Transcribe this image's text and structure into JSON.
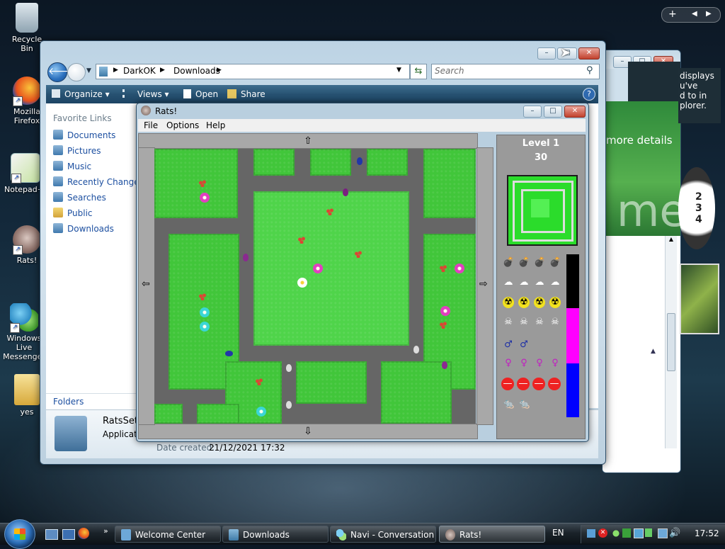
{
  "desktop": {
    "icons": [
      {
        "label": "Recycle Bin"
      },
      {
        "label": "Mozilla Firefox"
      },
      {
        "label": "Notepad++"
      },
      {
        "label": "Rats!"
      },
      {
        "label": "Windows Live Messenger"
      },
      {
        "label": "yes"
      }
    ]
  },
  "bg_window": {
    "text_lines": [
      "displays",
      "u've",
      "d to in",
      "plorer."
    ],
    "more_details": "more details",
    "me": "me"
  },
  "explorer": {
    "breadcrumb": [
      "DarkOK",
      "Downloads"
    ],
    "search_placeholder": "Search",
    "toolbar": {
      "organize": "Organize",
      "views": "Views",
      "open": "Open",
      "share": "Share"
    },
    "favorite_links_label": "Favorite Links",
    "links": [
      "Documents",
      "Pictures",
      "Music",
      "Recently Changed",
      "Searches",
      "Public",
      "Downloads"
    ],
    "folders_label": "Folders",
    "details": {
      "name": "RatsSetu",
      "type": "Applicati",
      "date_created_label": "Date created:",
      "date_created_value": "21/12/2021 17:32"
    }
  },
  "rats": {
    "title": "Rats!",
    "menu": [
      "File",
      "Options",
      "Help"
    ],
    "level_label": "Level 1",
    "score": "30",
    "weapons": {
      "bombs": 4,
      "gas": 4,
      "radiation": 4,
      "poison": 4,
      "male_change": 2,
      "female_change": 4,
      "stop_sign": 4,
      "rat_plus": 2
    },
    "bars": {
      "black_fraction": 0.33,
      "magenta_fraction": 0.33,
      "blue_fraction": 0.34
    }
  },
  "taskbar": {
    "tasks": [
      {
        "label": "Welcome Center",
        "active": false
      },
      {
        "label": "Downloads",
        "active": false
      },
      {
        "label": "Navi - Conversation",
        "active": false
      },
      {
        "label": "Rats!",
        "active": true
      }
    ],
    "language": "EN",
    "clock": "17:52"
  },
  "colors": {
    "accent": "#1d4564",
    "grass": "#41c63a",
    "road": "#666666",
    "magenta_bar": "#ff00ff",
    "blue_bar": "#0000ff"
  }
}
